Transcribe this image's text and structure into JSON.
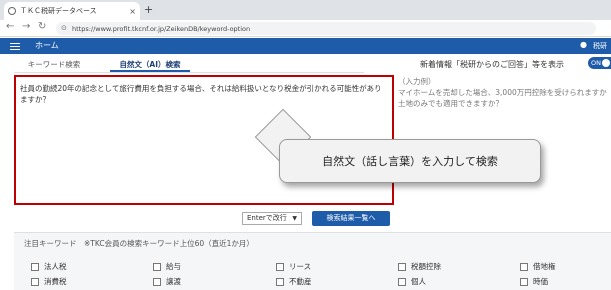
{
  "browser": {
    "tab_title": "ＴＫＣ税研データベース",
    "tab_close": "×",
    "new_tab": "+",
    "url": "https://www.profit.tkcnf.or.jp/ZeikenDB/keyword-option"
  },
  "app": {
    "home_label": "ホーム",
    "help_label": "税研"
  },
  "search_tabs": {
    "keyword": "キーワード検索",
    "natural": "自然文（AI）検索"
  },
  "news": {
    "label": "新着情報「税研からのご回答」等を表示",
    "toggle_label": "ON"
  },
  "query": {
    "text": "社員の勤続20年の記念として旅行費用を負担する場合、それは給料扱いとなり税金が引かれる可能性がありますか？"
  },
  "example": {
    "heading": "（入力例）",
    "line1": "マイホームを売却した場合、3,000万円控除を受けられますか",
    "line2": "土地のみでも適用できますか？"
  },
  "callout": {
    "text": "自然文（話し言葉）を入力して検索"
  },
  "controls": {
    "enter_select": "Enterで改行",
    "search_button": "検索結果一覧へ"
  },
  "keywords": {
    "title": "注目キーワード　※TKC会員の検索キーワード上位60（直近1か月）",
    "row1": [
      "法人税",
      "給与",
      "リース",
      "税額控除",
      "借地権"
    ],
    "row2": [
      "消費税",
      "譲渡",
      "不動産",
      "個人",
      "時価"
    ]
  }
}
